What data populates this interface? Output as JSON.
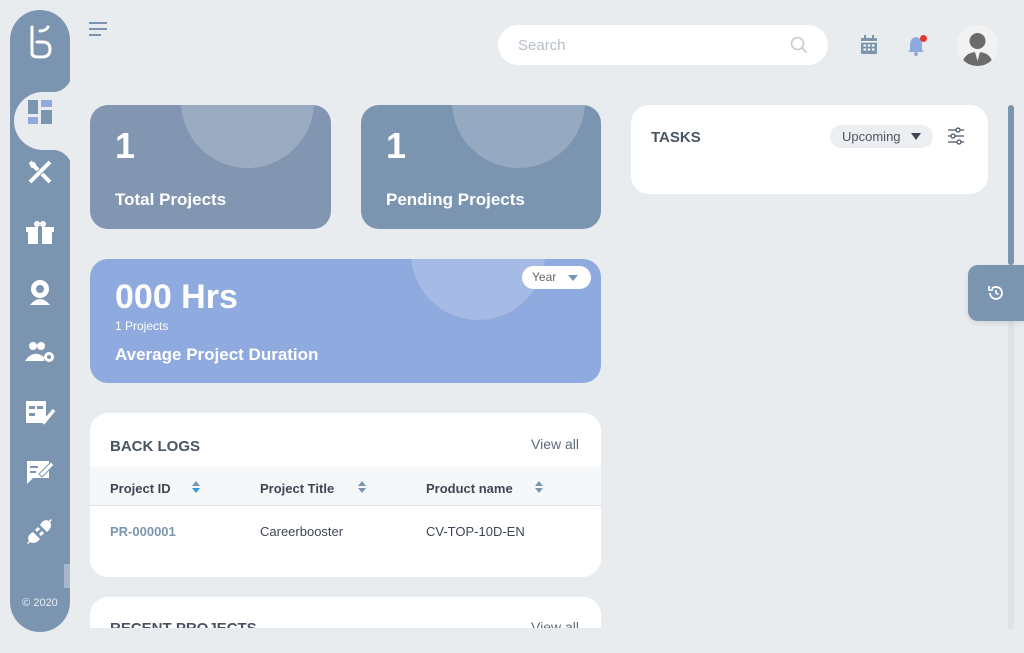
{
  "sidebar": {
    "logo": "brand-logo-icon",
    "items": [
      {
        "name": "dashboard",
        "icon": "dashboard-icon"
      },
      {
        "name": "tools",
        "icon": "tools-icon"
      },
      {
        "name": "packages",
        "icon": "package-icon"
      },
      {
        "name": "settings",
        "icon": "settings-person-icon"
      },
      {
        "name": "users",
        "icon": "users-settings-icon"
      },
      {
        "name": "tasks",
        "icon": "task-check-icon"
      },
      {
        "name": "notes",
        "icon": "edit-note-icon"
      },
      {
        "name": "integrations",
        "icon": "plug-icon"
      }
    ],
    "copyright": "© 2020"
  },
  "header": {
    "search_placeholder": "Search"
  },
  "stats": {
    "total_projects": {
      "value": "1",
      "label": "Total Projects"
    },
    "pending_projects": {
      "value": "1",
      "label": "Pending Projects"
    }
  },
  "duration": {
    "value": "000 Hrs",
    "projects": "1 Projects",
    "label": "Average Project Duration",
    "period": "Year"
  },
  "tasks": {
    "title": "TASKS",
    "filter": "Upcoming"
  },
  "backlogs": {
    "title": "BACK LOGS",
    "view_all": "View all",
    "columns": [
      "Project ID",
      "Project Title",
      "Product name"
    ],
    "rows": [
      {
        "id": "PR-000001",
        "title": "Careerbooster",
        "product": "CV-TOP-10D-EN"
      }
    ]
  },
  "recent": {
    "title": "RECENT PROJECTS",
    "view_all": "View all"
  },
  "colors": {
    "primary": "#7b95b1",
    "duration_card": "#8faadf",
    "background": "#e9ecef",
    "notification": "#e53935"
  }
}
